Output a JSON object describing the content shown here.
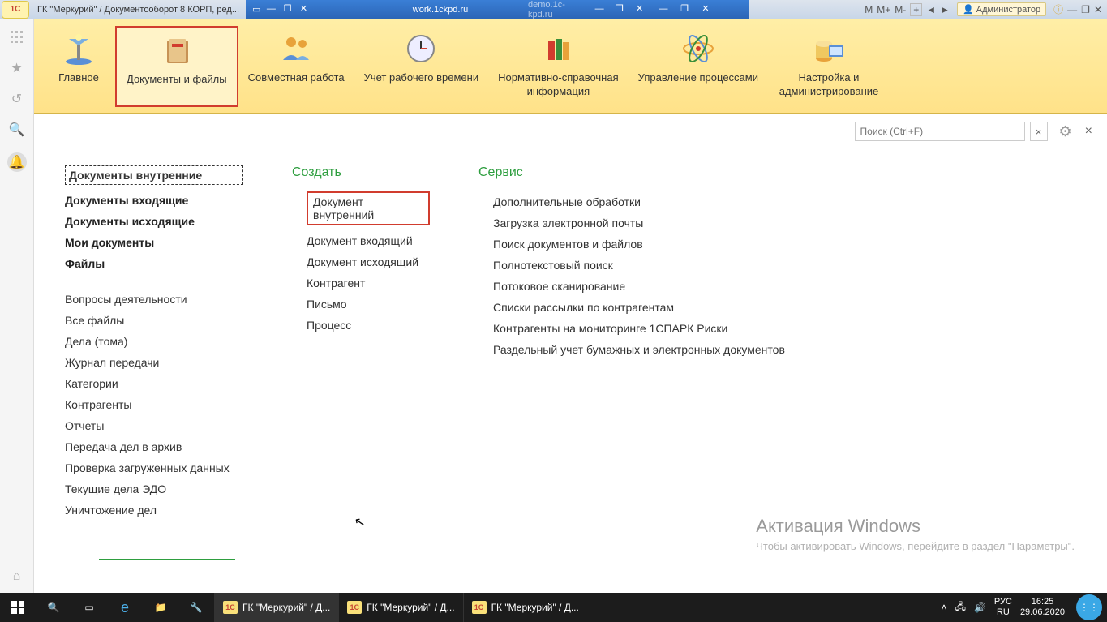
{
  "browser": {
    "app_icon": "1C",
    "title": "ГК \"Меркурий\" / Документооборот 8 КОРП, ред...",
    "tab2": "work.1ckpd.ru",
    "tab3": "demo.1c-kpd.ru",
    "m_labels": [
      "M",
      "M+",
      "M-"
    ],
    "user": "Администратор"
  },
  "nav": {
    "items": [
      {
        "label": "Главное"
      },
      {
        "label": "Документы и файлы"
      },
      {
        "label": "Совместная работа"
      },
      {
        "label": "Учет рабочего времени"
      },
      {
        "label": "Нормативно-справочная\nинформация"
      },
      {
        "label": "Управление процессами"
      },
      {
        "label": "Настройка и\nадминистрирование"
      }
    ]
  },
  "search": {
    "placeholder": "Поиск (Ctrl+F)"
  },
  "col_left": {
    "links_bold": [
      "Документы внутренние",
      "Документы входящие",
      "Документы исходящие",
      "Мои документы",
      "Файлы"
    ],
    "links_plain": [
      "Вопросы деятельности",
      "Все файлы",
      "Дела (тома)",
      "Журнал передачи",
      "Категории",
      "Контрагенты",
      "Отчеты",
      "Передача дел в архив",
      "Проверка загруженных данных",
      "Текущие дела ЭДО",
      "Уничтожение дел"
    ]
  },
  "col_create": {
    "title": "Создать",
    "links": [
      "Документ внутренний",
      "Документ входящий",
      "Документ исходящий",
      "Контрагент",
      "Письмо",
      "Процесс"
    ]
  },
  "col_service": {
    "title": "Сервис",
    "links": [
      "Дополнительные обработки",
      "Загрузка электронной почты",
      "Поиск документов и файлов",
      "Полнотекстовый поиск",
      "Потоковое сканирование",
      "Списки рассылки по контрагентам",
      "Контрагенты на мониторинге 1СПАРК Риски",
      "Раздельный учет бумажных и электронных документов"
    ]
  },
  "watermark": {
    "title": "Активация Windows",
    "text": "Чтобы активировать Windows, перейдите в раздел \"Параметры\"."
  },
  "taskbar": {
    "tasks": [
      "ГК \"Меркурий\" / Д...",
      "ГК \"Меркурий\" / Д...",
      "ГК \"Меркурий\" / Д..."
    ],
    "lang1": "РУС",
    "lang2": "RU",
    "time": "16:25",
    "date": "29.06.2020"
  }
}
